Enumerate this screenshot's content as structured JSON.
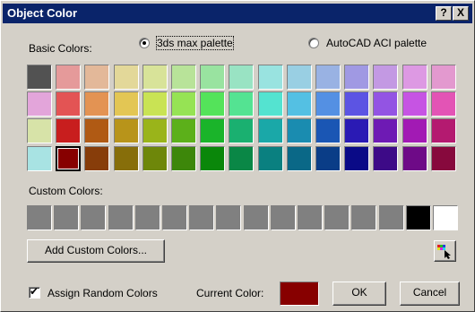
{
  "window": {
    "title": "Object Color",
    "help_glyph": "?",
    "close_glyph": "X"
  },
  "basic_colors": {
    "label": "Basic Colors:",
    "palette_options": [
      {
        "label": "3ds max palette",
        "selected": true
      },
      {
        "label": "AutoCAD ACI palette",
        "selected": false
      }
    ],
    "rows": [
      [
        "#525252",
        "#e59a9a",
        "#e3b899",
        "#e3d899",
        "#d8e399",
        "#b8e399",
        "#99e3a0",
        "#99e3c3",
        "#99e3e0",
        "#99cfe3",
        "#99b2e3",
        "#a099e3",
        "#c399e3",
        "#dd99e3",
        "#e399cf"
      ],
      [
        "#e3a5da",
        "#e35454",
        "#e39353",
        "#e3c654",
        "#c9e354",
        "#96e354",
        "#54e35a",
        "#54e392",
        "#54e3d0",
        "#54c0e3",
        "#5490e3",
        "#5c54e3",
        "#9354e3",
        "#c654e3",
        "#e354b5"
      ],
      [
        "#d7e3a8",
        "#c81e1e",
        "#b05a14",
        "#b8941a",
        "#9ab41a",
        "#5cb01a",
        "#1ab42a",
        "#1ab070",
        "#1aa8a8",
        "#1a8cb0",
        "#1a56b4",
        "#2a1ab4",
        "#6e1ab4",
        "#a21ab4",
        "#b41a70"
      ],
      [
        "#a8e3e3",
        "#870000",
        "#873d0a",
        "#876e0a",
        "#6e870a",
        "#3d870a",
        "#0a870a",
        "#0a8746",
        "#0a8080",
        "#0a6887",
        "#0a3d87",
        "#0a0a87",
        "#3d0a87",
        "#6e0a87",
        "#87093d"
      ]
    ],
    "selected_cell": {
      "row": 3,
      "col": 1
    }
  },
  "custom_colors": {
    "label": "Custom Colors:",
    "swatches": [
      "#808080",
      "#808080",
      "#808080",
      "#808080",
      "#808080",
      "#808080",
      "#808080",
      "#808080",
      "#808080",
      "#808080",
      "#808080",
      "#808080",
      "#808080",
      "#808080",
      "#000000",
      "#ffffff"
    ],
    "add_button_label": "Add Custom Colors..."
  },
  "picker_icon": "color-picker-icon",
  "footer": {
    "assign_random_label": "Assign Random Colors",
    "assign_random_checked": true,
    "check_glyph": "✔",
    "current_color_label": "Current Color:",
    "current_color": "#870000",
    "ok_label": "OK",
    "cancel_label": "Cancel"
  }
}
